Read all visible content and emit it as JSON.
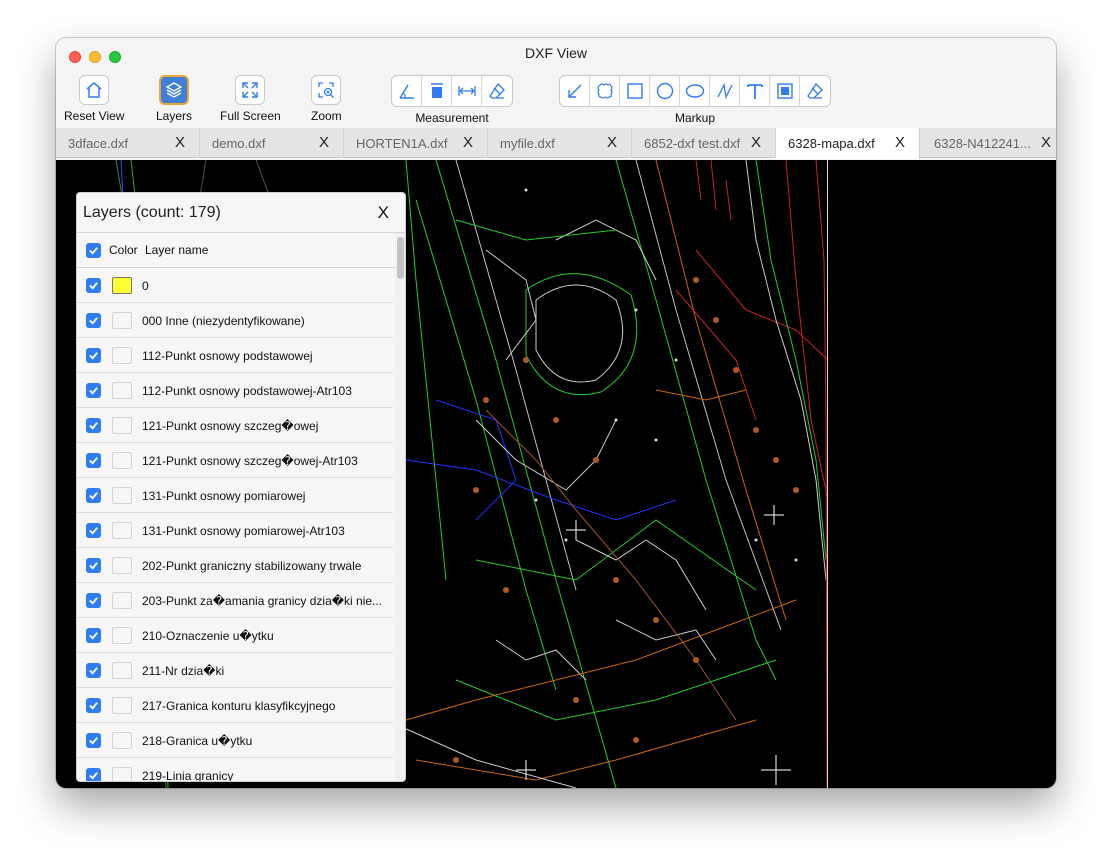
{
  "window": {
    "title": "DXF View"
  },
  "toolbar": {
    "reset_view": {
      "label": "Reset View",
      "icon": "home-icon"
    },
    "layers": {
      "label": "Layers",
      "icon": "layers-icon"
    },
    "full_screen": {
      "label": "Full Screen",
      "icon": "expand-icon"
    },
    "zoom": {
      "label": "Zoom",
      "icon": "zoom-in-icon"
    },
    "measurement": {
      "label": "Measurement",
      "tools": [
        "angle-measure-icon",
        "area-measure-icon",
        "distance-measure-icon",
        "eraser-icon"
      ]
    },
    "markup": {
      "label": "Markup",
      "tools": [
        "arrow-icon",
        "cloud-icon",
        "rectangle-icon",
        "circle-icon",
        "ellipse-icon",
        "freehand-icon",
        "text-icon",
        "filled-rectangle-icon",
        "eraser-icon"
      ]
    }
  },
  "tabs": [
    {
      "label": "3dface.dxf",
      "close": "X"
    },
    {
      "label": "demo.dxf",
      "close": "X"
    },
    {
      "label": "HORTEN1A.dxf",
      "close": "X"
    },
    {
      "label": "myfile.dxf",
      "close": "X"
    },
    {
      "label": "6852-dxf test.dxf",
      "close": "X"
    },
    {
      "label": "6328-mapa.dxf",
      "close": "X",
      "active": true
    },
    {
      "label": "6328-N412241...",
      "close": "X"
    }
  ],
  "layers_panel": {
    "title": "Layers (count: 179)",
    "close": "X",
    "col_color": "Color",
    "col_name": "Layer name",
    "rows": [
      {
        "name": "0",
        "color": "#ffff33"
      },
      {
        "name": "000 Inne (niezydentyfikowane)"
      },
      {
        "name": "112-Punkt osnowy podstawowej"
      },
      {
        "name": "112-Punkt osnowy podstawowej-Atr103"
      },
      {
        "name": "121-Punkt osnowy szczeg�owej"
      },
      {
        "name": "121-Punkt osnowy szczeg�owej-Atr103"
      },
      {
        "name": "131-Punkt osnowy pomiarowej"
      },
      {
        "name": "131-Punkt osnowy pomiarowej-Atr103"
      },
      {
        "name": "202-Punkt graniczny stabilizowany trwale"
      },
      {
        "name": "203-Punkt za�amania granicy dzia�ki nie..."
      },
      {
        "name": "210-Oznaczenie u�ytku"
      },
      {
        "name": "211-Nr dzia�ki"
      },
      {
        "name": "217-Granica konturu klasyfikcyjnego"
      },
      {
        "name": "218-Granica u�ytku"
      },
      {
        "name": "219-Linia granicy"
      }
    ]
  },
  "colors": {
    "accent": "#2f7cf6",
    "canvas": "#000000",
    "active_border": "#e8a53a"
  }
}
